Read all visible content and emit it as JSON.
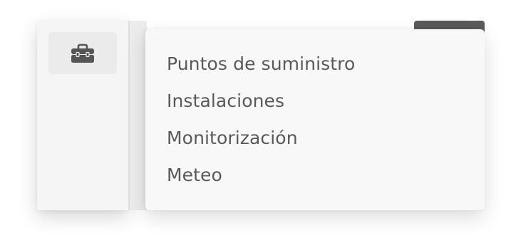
{
  "sidebar": {
    "tool_icon": "toolbox-icon"
  },
  "menu": {
    "items": [
      {
        "label": "Puntos de suministro"
      },
      {
        "label": "Instalaciones"
      },
      {
        "label": "Monitorización"
      },
      {
        "label": "Meteo"
      }
    ]
  }
}
